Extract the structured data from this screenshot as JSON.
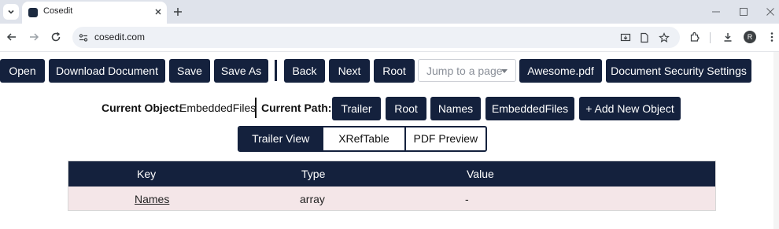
{
  "browser": {
    "tab_title": "Cosedit",
    "url": "cosedit.com",
    "profile_initial": "R"
  },
  "toolbar": {
    "buttons": [
      "Open",
      "Download Document",
      "Save",
      "Save As"
    ],
    "nav_buttons": [
      "Back",
      "Next",
      "Root"
    ],
    "jump_placeholder": "Jump to a page",
    "file_button": "Awesome.pdf",
    "security_button": "Document Security Settings"
  },
  "object_bar": {
    "current_object_label": "Current Object:",
    "current_object_value": "EmbeddedFiles",
    "current_path_label": "Current Path:",
    "path": [
      "Trailer",
      "Root",
      "Names",
      "EmbeddedFiles"
    ],
    "add_button": "+ Add New Object"
  },
  "view_tabs": {
    "items": [
      "Trailer View",
      "XRefTable",
      "PDF Preview"
    ],
    "active": "Trailer View"
  },
  "table": {
    "headers": [
      "Key",
      "Type",
      "Value"
    ],
    "rows": [
      {
        "key": "Names",
        "type": "array",
        "value": "-"
      }
    ]
  },
  "colors": {
    "primary": "#14213d",
    "row_bg": "#f4e6e8"
  }
}
